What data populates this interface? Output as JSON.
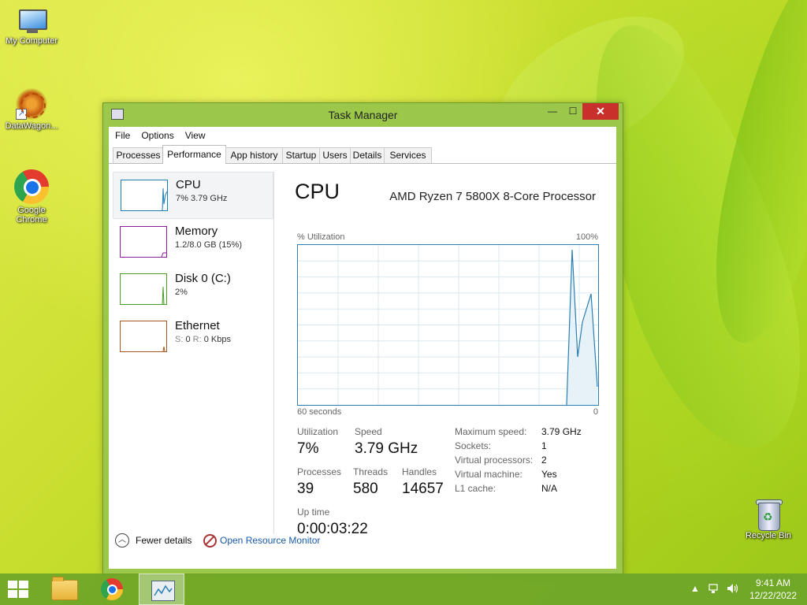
{
  "desktop": {
    "icons": {
      "my_computer": "My Computer",
      "datawagon": "DataWagon...",
      "chrome_line1": "Google",
      "chrome_line2": "Chrome",
      "recycle_bin": "Recycle Bin"
    }
  },
  "window": {
    "title": "Task Manager",
    "controls": {
      "minimize": "—",
      "maximize": "☐",
      "close": "✕"
    },
    "menu": [
      "File",
      "Options",
      "View"
    ],
    "tabs": [
      "Processes",
      "Performance",
      "App history",
      "Startup",
      "Users",
      "Details",
      "Services"
    ],
    "active_tab": "Performance"
  },
  "sidebar": {
    "items": [
      {
        "name": "CPU",
        "sub": "7% 3.79 GHz",
        "color": "#1d7eb5"
      },
      {
        "name": "Memory",
        "sub": "1.2/8.0 GB (15%)",
        "color": "#8b1a9c"
      },
      {
        "name": "Disk 0 (C:)",
        "sub": "2%",
        "color": "#4a9a26"
      },
      {
        "name": "Ethernet",
        "sub_s": "S:",
        "sub_s_val": "0",
        "sub_r": "R:",
        "sub_r_val": "0 Kbps",
        "color": "#a6561e"
      }
    ]
  },
  "detail": {
    "title": "CPU",
    "processor": "AMD Ryzen 7 5800X 8-Core Processor",
    "graph": {
      "y_label": "% Utilization",
      "y_max_label": "100%",
      "x_left_label": "60 seconds",
      "x_right_label": "0",
      "line_color": "#2a7fb2"
    },
    "stats": {
      "utilization_label": "Utilization",
      "utilization": "7%",
      "speed_label": "Speed",
      "speed": "3.79 GHz",
      "processes_label": "Processes",
      "processes": "39",
      "threads_label": "Threads",
      "threads": "580",
      "handles_label": "Handles",
      "handles": "14657",
      "uptime_label": "Up time",
      "uptime": "0:00:03:22"
    },
    "specs": [
      {
        "key": "Maximum speed:",
        "value": "3.79 GHz"
      },
      {
        "key": "Sockets:",
        "value": "1"
      },
      {
        "key": "Virtual processors:",
        "value": "2"
      },
      {
        "key": "Virtual machine:",
        "value": "Yes"
      },
      {
        "key": "L1 cache:",
        "value": "N/A"
      }
    ]
  },
  "footer": {
    "fewer_details": "Fewer details",
    "open_resource_monitor": "Open Resource Monitor"
  },
  "taskbar": {
    "time": "9:41 AM",
    "date": "12/22/2022",
    "tray_icons": [
      "chevron-up-icon",
      "network-icon",
      "volume-icon"
    ]
  }
}
